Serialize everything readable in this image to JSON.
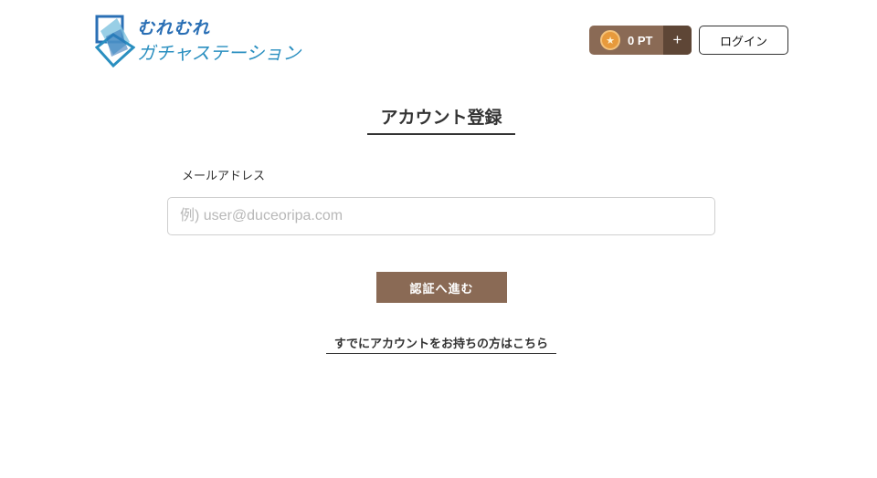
{
  "header": {
    "logo": {
      "line1": "むれむれ",
      "line2": "ガチャステーション",
      "colors": {
        "primary": "#2a6fb5",
        "accent": "#2a8fc0"
      }
    },
    "points": {
      "value": "0 PT",
      "icon": "coin-icon",
      "add_label": "+"
    },
    "login_label": "ログイン"
  },
  "form": {
    "title": "アカウント登録",
    "email_label": "メールアドレス",
    "email_value": "",
    "email_placeholder": "例) user@duceoripa.com",
    "submit_label": "認証へ進む",
    "existing_account_link": "すでにアカウントをお持ちの方はこちら"
  },
  "theme": {
    "brand": "#8a6a55",
    "brand_dark": "#5e4636",
    "coin": "#e79a3c"
  }
}
